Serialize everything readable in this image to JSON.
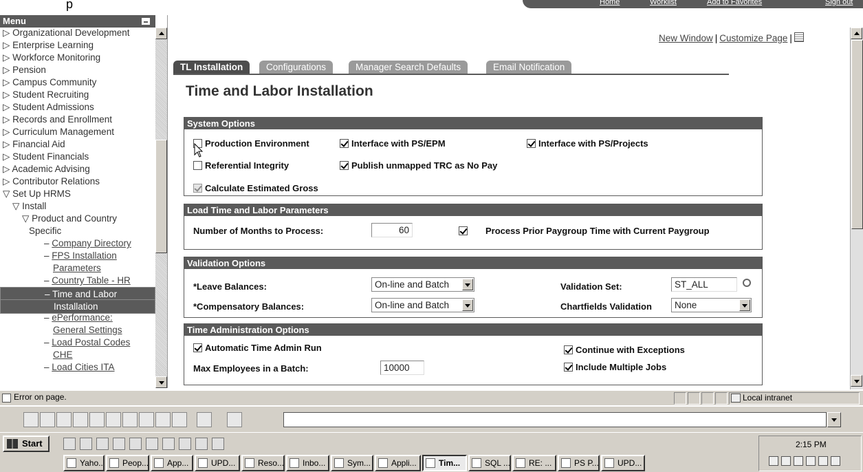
{
  "browser": {
    "top_links": [
      "Home",
      "Worklist",
      "Add to Favorites",
      "Sign out"
    ]
  },
  "menu": {
    "title": "Menu",
    "items": [
      {
        "label": "Organizational Development",
        "level": 0,
        "type": "collapsed"
      },
      {
        "label": "Enterprise Learning",
        "level": 0,
        "type": "collapsed"
      },
      {
        "label": "Workforce Monitoring",
        "level": 0,
        "type": "collapsed"
      },
      {
        "label": "Pension",
        "level": 0,
        "type": "collapsed"
      },
      {
        "label": "Campus Community",
        "level": 0,
        "type": "collapsed"
      },
      {
        "label": "Student Recruiting",
        "level": 0,
        "type": "collapsed"
      },
      {
        "label": "Student Admissions",
        "level": 0,
        "type": "collapsed"
      },
      {
        "label": "Records and Enrollment",
        "level": 0,
        "type": "collapsed"
      },
      {
        "label": "Curriculum Management",
        "level": 0,
        "type": "collapsed"
      },
      {
        "label": "Financial Aid",
        "level": 0,
        "type": "collapsed"
      },
      {
        "label": "Student Financials",
        "level": 0,
        "type": "collapsed"
      },
      {
        "label": "Academic Advising",
        "level": 0,
        "type": "collapsed"
      },
      {
        "label": "Contributor Relations",
        "level": 0,
        "type": "collapsed"
      },
      {
        "label": "Set Up HRMS",
        "level": 0,
        "type": "expanded"
      },
      {
        "label": "Install",
        "level": 1,
        "type": "expanded"
      },
      {
        "label": "Product and Country",
        "level": 2,
        "type": "expanded"
      },
      {
        "label": "Specific",
        "level": 2,
        "type": "cont"
      },
      {
        "label": "Company Directory",
        "level": 3,
        "type": "link"
      },
      {
        "label": "FPS Installation",
        "level": 3,
        "type": "link"
      },
      {
        "label": "Parameters",
        "level": 3,
        "type": "linkcont"
      },
      {
        "label": "Country Table - HR",
        "level": 3,
        "type": "link"
      },
      {
        "label": "Time and Labor",
        "level": 3,
        "type": "selected"
      },
      {
        "label": "Installation",
        "level": 3,
        "type": "selcont"
      },
      {
        "label": "ePerformance:",
        "level": 3,
        "type": "link"
      },
      {
        "label": "General Settings",
        "level": 3,
        "type": "linkcont"
      },
      {
        "label": "Load Postal Codes",
        "level": 3,
        "type": "link"
      },
      {
        "label": "CHE",
        "level": 3,
        "type": "linkcont"
      },
      {
        "label": "Load Cities ITA",
        "level": 3,
        "type": "link"
      }
    ]
  },
  "page_links": {
    "new_window": "New Window",
    "customize": "Customize Page",
    "sep": "|"
  },
  "tabs": [
    "TL Installation",
    "Configurations",
    "Manager Search Defaults",
    "Email Notification"
  ],
  "page_title": "Time and Labor Installation",
  "system_options": {
    "header": "System Options",
    "production_env": {
      "label": "Production Environment",
      "checked": false
    },
    "interface_epm": {
      "label": "Interface with PS/EPM",
      "checked": true
    },
    "interface_projects": {
      "label": "Interface with PS/Projects",
      "checked": true
    },
    "referential": {
      "label": "Referential Integrity",
      "checked": false
    },
    "publish_unmapped": {
      "label": "Publish unmapped TRC as No Pay",
      "checked": true
    },
    "calc_gross": {
      "label": "Calculate Estimated Gross",
      "checked": true,
      "disabled": true
    }
  },
  "load_params": {
    "header": "Load Time and Labor Parameters",
    "months_label": "Number of Months to Process:",
    "months_value": "60",
    "process_prior_label": "Process Prior Paygroup Time with Current Paygroup",
    "process_prior_checked": true
  },
  "validation": {
    "header": "Validation Options",
    "leave_label": "*Leave Balances:",
    "leave_value": "On-line and Batch",
    "comp_label": "*Compensatory Balances:",
    "comp_value": "On-line and Batch",
    "valset_label": "Validation Set:",
    "valset_value": "ST_ALL",
    "chartfields_label": "Chartfields Validation",
    "chartfields_value": "None"
  },
  "time_admin": {
    "header": "Time Administration Options",
    "auto_run": {
      "label": "Automatic Time Admin Run",
      "checked": true
    },
    "continue_exc": {
      "label": "Continue with Exceptions",
      "checked": true
    },
    "max_label": "Max Employees in a Batch:",
    "max_value": "10000",
    "multi_jobs": {
      "label": "Include Multiple Jobs",
      "checked": true
    }
  },
  "status": {
    "text": "Error on page.",
    "zone": "Local intranet"
  },
  "taskbar": {
    "start": "Start",
    "clock": "2:15 PM",
    "tasks": [
      "Yaho...",
      "Peop...",
      "App...",
      "UPD...",
      "Reso...",
      "Inbo...",
      "Sym...",
      "Appli...",
      "Tim...",
      "SQL ...",
      "RE: ...",
      "PS P...",
      "UPD..."
    ],
    "active_task": 8
  }
}
